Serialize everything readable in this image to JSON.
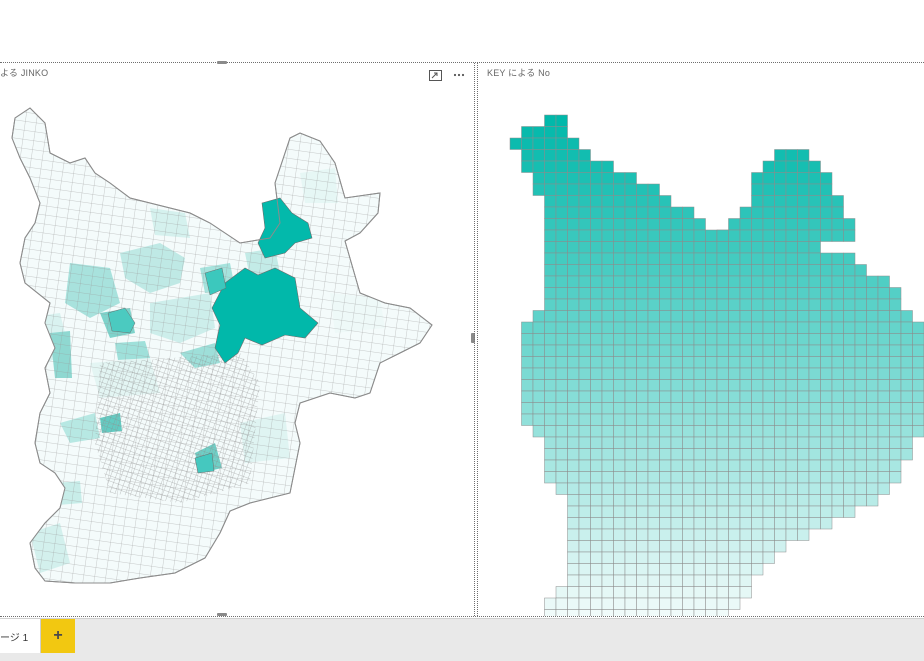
{
  "visuals": {
    "left": {
      "title": "よる JINKO",
      "icons": [
        "focus-mode-icon",
        "more-options-icon"
      ]
    },
    "right": {
      "title": "KEY による No"
    }
  },
  "tabs": {
    "pages": [
      {
        "label": "ージ 1",
        "selected": true
      }
    ],
    "add_label": "+"
  },
  "colors": {
    "accent_teal": "#01b8aa",
    "light_teal": "#e8f7f6",
    "add_tab_yellow": "#f2c811",
    "border_gray": "#8c8c8c"
  }
}
